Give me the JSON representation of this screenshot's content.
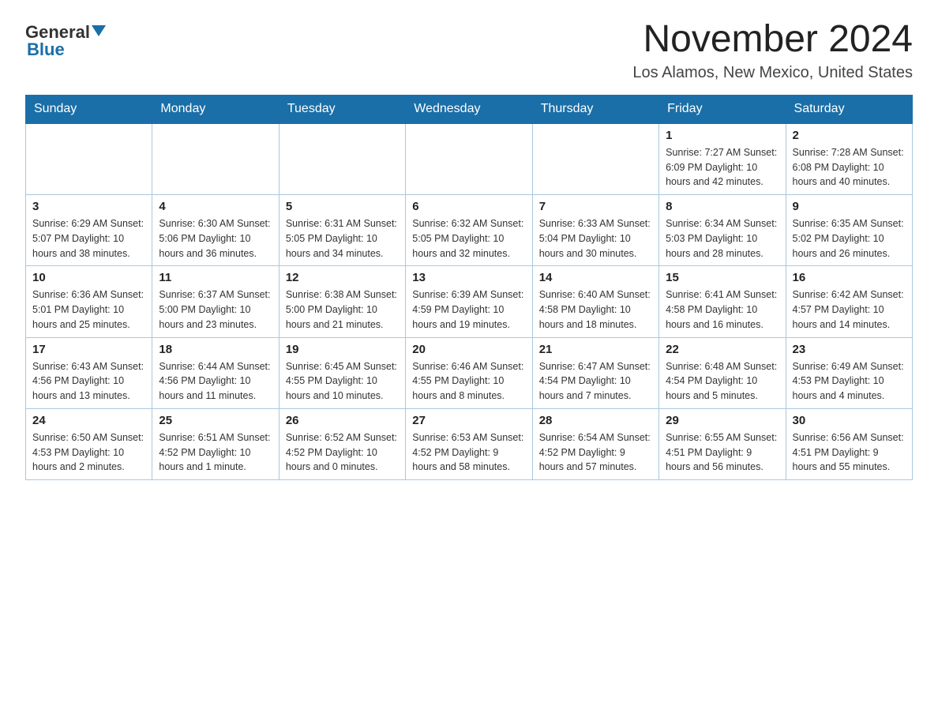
{
  "logo": {
    "text_general": "General",
    "text_blue": "Blue"
  },
  "title": "November 2024",
  "subtitle": "Los Alamos, New Mexico, United States",
  "weekdays": [
    "Sunday",
    "Monday",
    "Tuesday",
    "Wednesday",
    "Thursday",
    "Friday",
    "Saturday"
  ],
  "weeks": [
    [
      {
        "day": "",
        "info": ""
      },
      {
        "day": "",
        "info": ""
      },
      {
        "day": "",
        "info": ""
      },
      {
        "day": "",
        "info": ""
      },
      {
        "day": "",
        "info": ""
      },
      {
        "day": "1",
        "info": "Sunrise: 7:27 AM\nSunset: 6:09 PM\nDaylight: 10 hours and 42 minutes."
      },
      {
        "day": "2",
        "info": "Sunrise: 7:28 AM\nSunset: 6:08 PM\nDaylight: 10 hours and 40 minutes."
      }
    ],
    [
      {
        "day": "3",
        "info": "Sunrise: 6:29 AM\nSunset: 5:07 PM\nDaylight: 10 hours and 38 minutes."
      },
      {
        "day": "4",
        "info": "Sunrise: 6:30 AM\nSunset: 5:06 PM\nDaylight: 10 hours and 36 minutes."
      },
      {
        "day": "5",
        "info": "Sunrise: 6:31 AM\nSunset: 5:05 PM\nDaylight: 10 hours and 34 minutes."
      },
      {
        "day": "6",
        "info": "Sunrise: 6:32 AM\nSunset: 5:05 PM\nDaylight: 10 hours and 32 minutes."
      },
      {
        "day": "7",
        "info": "Sunrise: 6:33 AM\nSunset: 5:04 PM\nDaylight: 10 hours and 30 minutes."
      },
      {
        "day": "8",
        "info": "Sunrise: 6:34 AM\nSunset: 5:03 PM\nDaylight: 10 hours and 28 minutes."
      },
      {
        "day": "9",
        "info": "Sunrise: 6:35 AM\nSunset: 5:02 PM\nDaylight: 10 hours and 26 minutes."
      }
    ],
    [
      {
        "day": "10",
        "info": "Sunrise: 6:36 AM\nSunset: 5:01 PM\nDaylight: 10 hours and 25 minutes."
      },
      {
        "day": "11",
        "info": "Sunrise: 6:37 AM\nSunset: 5:00 PM\nDaylight: 10 hours and 23 minutes."
      },
      {
        "day": "12",
        "info": "Sunrise: 6:38 AM\nSunset: 5:00 PM\nDaylight: 10 hours and 21 minutes."
      },
      {
        "day": "13",
        "info": "Sunrise: 6:39 AM\nSunset: 4:59 PM\nDaylight: 10 hours and 19 minutes."
      },
      {
        "day": "14",
        "info": "Sunrise: 6:40 AM\nSunset: 4:58 PM\nDaylight: 10 hours and 18 minutes."
      },
      {
        "day": "15",
        "info": "Sunrise: 6:41 AM\nSunset: 4:58 PM\nDaylight: 10 hours and 16 minutes."
      },
      {
        "day": "16",
        "info": "Sunrise: 6:42 AM\nSunset: 4:57 PM\nDaylight: 10 hours and 14 minutes."
      }
    ],
    [
      {
        "day": "17",
        "info": "Sunrise: 6:43 AM\nSunset: 4:56 PM\nDaylight: 10 hours and 13 minutes."
      },
      {
        "day": "18",
        "info": "Sunrise: 6:44 AM\nSunset: 4:56 PM\nDaylight: 10 hours and 11 minutes."
      },
      {
        "day": "19",
        "info": "Sunrise: 6:45 AM\nSunset: 4:55 PM\nDaylight: 10 hours and 10 minutes."
      },
      {
        "day": "20",
        "info": "Sunrise: 6:46 AM\nSunset: 4:55 PM\nDaylight: 10 hours and 8 minutes."
      },
      {
        "day": "21",
        "info": "Sunrise: 6:47 AM\nSunset: 4:54 PM\nDaylight: 10 hours and 7 minutes."
      },
      {
        "day": "22",
        "info": "Sunrise: 6:48 AM\nSunset: 4:54 PM\nDaylight: 10 hours and 5 minutes."
      },
      {
        "day": "23",
        "info": "Sunrise: 6:49 AM\nSunset: 4:53 PM\nDaylight: 10 hours and 4 minutes."
      }
    ],
    [
      {
        "day": "24",
        "info": "Sunrise: 6:50 AM\nSunset: 4:53 PM\nDaylight: 10 hours and 2 minutes."
      },
      {
        "day": "25",
        "info": "Sunrise: 6:51 AM\nSunset: 4:52 PM\nDaylight: 10 hours and 1 minute."
      },
      {
        "day": "26",
        "info": "Sunrise: 6:52 AM\nSunset: 4:52 PM\nDaylight: 10 hours and 0 minutes."
      },
      {
        "day": "27",
        "info": "Sunrise: 6:53 AM\nSunset: 4:52 PM\nDaylight: 9 hours and 58 minutes."
      },
      {
        "day": "28",
        "info": "Sunrise: 6:54 AM\nSunset: 4:52 PM\nDaylight: 9 hours and 57 minutes."
      },
      {
        "day": "29",
        "info": "Sunrise: 6:55 AM\nSunset: 4:51 PM\nDaylight: 9 hours and 56 minutes."
      },
      {
        "day": "30",
        "info": "Sunrise: 6:56 AM\nSunset: 4:51 PM\nDaylight: 9 hours and 55 minutes."
      }
    ]
  ]
}
